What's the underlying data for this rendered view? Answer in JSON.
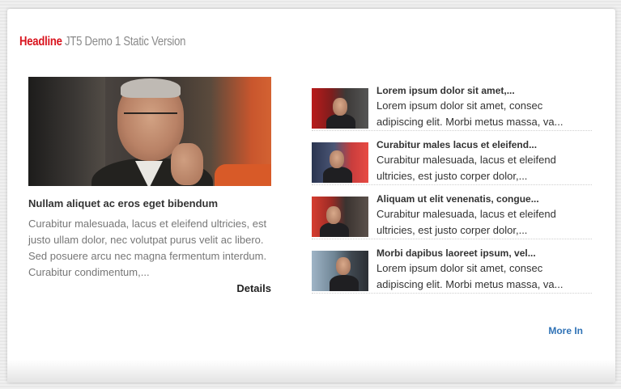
{
  "module": {
    "headline_label": "Headline",
    "title": "JT5 Demo 1 Static Version"
  },
  "featured": {
    "image_icon": "featured-photo",
    "title": "Nullam aliquet ac eros eget bibendum",
    "text": "Curabitur malesuada, lacus et eleifend ultricies, est justo ullam dolor, nec volutpat purus velit ac libero. Sed posuere arcu nec magna fermentum interdum. Curabitur condimentum,...",
    "details_label": "Details"
  },
  "items": [
    {
      "title": "Lorem ipsum dolor sit amet,...",
      "text": "Lorem ipsum dolor sit amet, consec adipiscing elit. Morbi metus massa, va...",
      "thumb_icon": "thumbnail-photo-1"
    },
    {
      "title": "Curabitur males lacus et eleifend...",
      "text": "Curabitur malesuada, lacus et eleifend ultricies, est justo corper dolor,...",
      "thumb_icon": "thumbnail-photo-2"
    },
    {
      "title": "Aliquam ut elit venenatis, congue...",
      "text": "Curabitur malesuada, lacus et eleifend ultricies, est justo corper dolor,...",
      "thumb_icon": "thumbnail-photo-3"
    },
    {
      "title": "Morbi dapibus laoreet ipsum, vel...",
      "text": "Lorem ipsum dolor sit amet, consec adipiscing elit. Morbi metus massa, va...",
      "thumb_icon": "thumbnail-photo-4"
    }
  ],
  "footer": {
    "more_label": "More In"
  },
  "colors": {
    "headline_accent": "#d9141e",
    "title_gray": "#8a8a8a",
    "link_blue": "#2f72b6"
  }
}
